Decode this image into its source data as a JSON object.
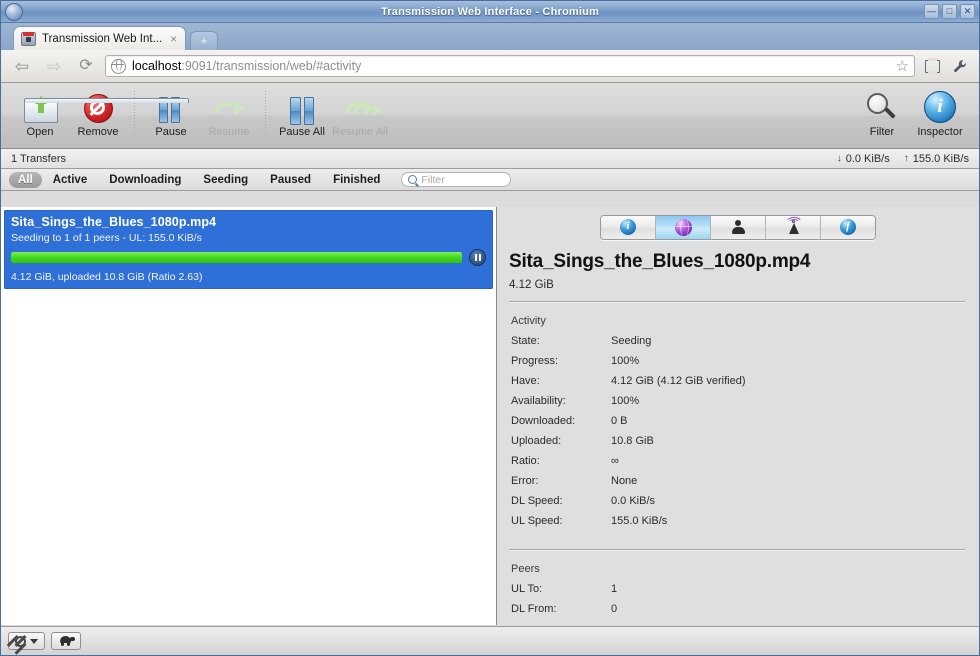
{
  "window": {
    "title": "Transmission Web Interface - Chromium",
    "app_icon": "chromium-icon",
    "controls": [
      {
        "name": "minimize-button",
        "glyph": "—"
      },
      {
        "name": "maximize-button",
        "glyph": "□"
      },
      {
        "name": "close-button",
        "glyph": "✕"
      }
    ]
  },
  "browser": {
    "tab": {
      "label": "Transmission Web Int...",
      "close_glyph": "×",
      "favicon": "transmission-favicon"
    },
    "new_tab_glyph": "+",
    "nav": {
      "back_glyph": "⇦",
      "forward_glyph": "⇨",
      "reload_glyph": "⟳"
    },
    "omnibox": {
      "url_host": "localhost",
      "url_rest": ":9091/transmission/web/#activity",
      "site_icon": "globe-icon",
      "star_glyph": "☆"
    },
    "tools": {
      "frame_icon": "window-frame-icon",
      "wrench_glyph": "🔧"
    }
  },
  "toolbar": {
    "buttons": [
      {
        "id": "open",
        "label": "Open",
        "icon": "open-folder-icon",
        "disabled": false
      },
      {
        "id": "remove",
        "label": "Remove",
        "icon": "remove-icon",
        "disabled": false
      },
      {
        "id": "pause",
        "label": "Pause",
        "icon": "pause-icon",
        "disabled": false
      },
      {
        "id": "resume",
        "label": "Resume",
        "icon": "resume-icon",
        "disabled": true
      },
      {
        "id": "pause-all",
        "label": "Pause All",
        "icon": "pause-all-icon",
        "disabled": false
      },
      {
        "id": "resume-all",
        "label": "Resume All",
        "icon": "resume-all-icon",
        "disabled": true
      },
      {
        "id": "filter",
        "label": "Filter",
        "icon": "magnifier-icon",
        "disabled": false
      },
      {
        "id": "inspector",
        "label": "Inspector",
        "icon": "info-icon",
        "disabled": false
      }
    ]
  },
  "statusline": {
    "transfers": "1 Transfers",
    "download_speed": "0.0 KiB/s",
    "upload_speed": "155.0 KiB/s",
    "download_arrow": "↓",
    "upload_arrow": "↑"
  },
  "filterbar": {
    "items": [
      {
        "label": "All",
        "active": true
      },
      {
        "label": "Active",
        "active": false
      },
      {
        "label": "Downloading",
        "active": false
      },
      {
        "label": "Seeding",
        "active": false
      },
      {
        "label": "Paused",
        "active": false
      },
      {
        "label": "Finished",
        "active": false
      }
    ],
    "search_placeholder": "Filter",
    "search_value": "",
    "search_icon": "search-icon"
  },
  "torrents": [
    {
      "name": "Sita_Sings_the_Blues_1080p.mp4",
      "status": "Seeding to 1 of 1 peers - UL: 155.0 KiB/s",
      "progress_percent": 100,
      "footer": "4.12 GiB, uploaded 10.8 GiB (Ratio 2.63)",
      "selected": true,
      "action_icon": "pause-circle-icon"
    }
  ],
  "inspector": {
    "tabs": [
      {
        "id": "info",
        "icon": "info-blue-icon",
        "selected": false
      },
      {
        "id": "activity",
        "icon": "globe-purple-icon",
        "selected": true
      },
      {
        "id": "peers",
        "icon": "person-icon",
        "selected": false
      },
      {
        "id": "tracker",
        "icon": "tracker-antenna-icon",
        "selected": false
      },
      {
        "id": "files",
        "icon": "files-f-icon",
        "selected": false
      }
    ],
    "title": "Sita_Sings_the_Blues_1080p.mp4",
    "size": "4.12 GiB",
    "sections": [
      {
        "heading": "Activity",
        "rows": [
          {
            "key": "State:",
            "value": "Seeding"
          },
          {
            "key": "Progress:",
            "value": "100%"
          },
          {
            "key": "Have:",
            "value": "4.12 GiB (4.12 GiB verified)"
          },
          {
            "key": "Availability:",
            "value": "100%"
          },
          {
            "key": "Downloaded:",
            "value": "0 B"
          },
          {
            "key": "Uploaded:",
            "value": "10.8 GiB"
          },
          {
            "key": "Ratio:",
            "value": "∞"
          },
          {
            "key": "Error:",
            "value": "None"
          },
          {
            "key": "DL Speed:",
            "value": "0.0 KiB/s"
          },
          {
            "key": "UL Speed:",
            "value": "155.0 KiB/s"
          }
        ]
      },
      {
        "heading": "Peers",
        "rows": [
          {
            "key": "UL To:",
            "value": "1"
          },
          {
            "key": "DL From:",
            "value": "0"
          }
        ]
      }
    ]
  },
  "bottombar": {
    "prefs_icon": "gear-icon",
    "prefs_caret": "caret-down-icon",
    "turtle_icon": "turtle-icon"
  },
  "colors": {
    "selection_blue": "#2f6fd8",
    "progress_green": "#3dd617",
    "titlebar_blue": "#7b9dc8",
    "panel_gray": "#dfdfdf"
  }
}
